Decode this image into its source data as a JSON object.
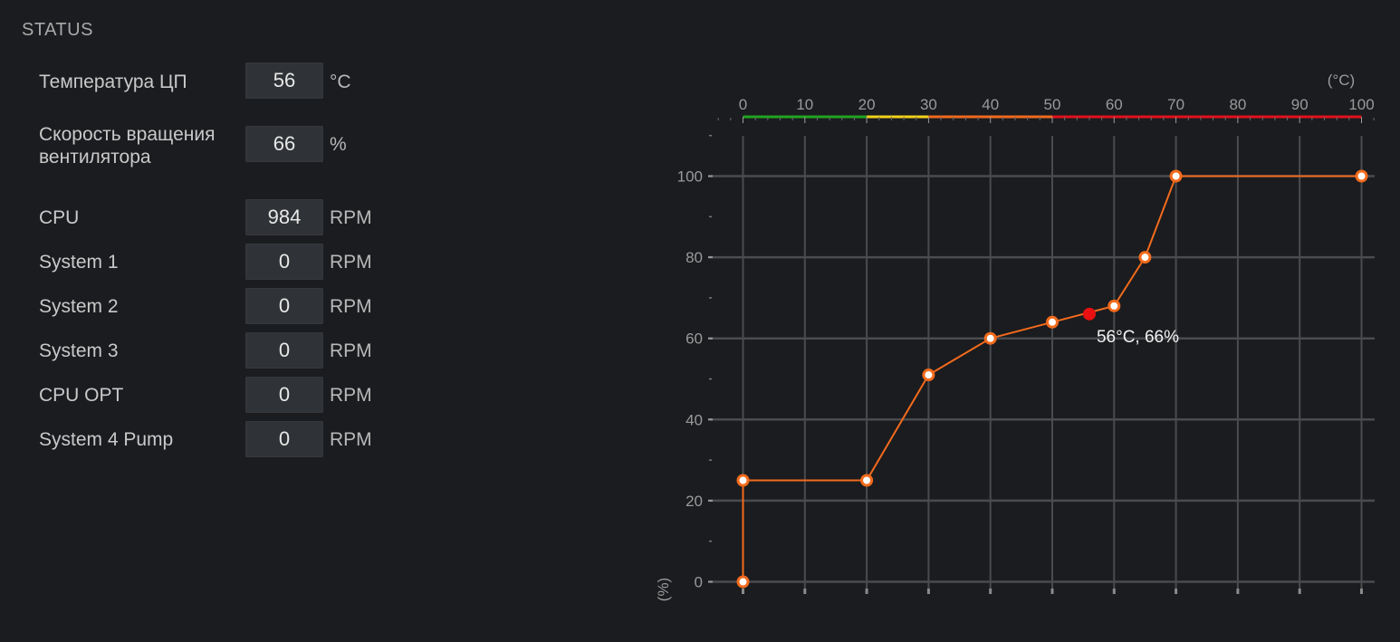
{
  "status": {
    "title": "STATUS",
    "cpu_temp": {
      "label": "Температура ЦП",
      "value": "56",
      "unit": "°C"
    },
    "fan_speed": {
      "label_line1": "Скорость вращения",
      "label_line2": "вентилятора",
      "value": "66",
      "unit": "%"
    },
    "fans": [
      {
        "label": "CPU",
        "value": "984",
        "unit": "RPM"
      },
      {
        "label": "System 1",
        "value": "0",
        "unit": "RPM"
      },
      {
        "label": "System 2",
        "value": "0",
        "unit": "RPM"
      },
      {
        "label": "System 3",
        "value": "0",
        "unit": "RPM"
      },
      {
        "label": "CPU OPT",
        "value": "0",
        "unit": "RPM"
      },
      {
        "label": "System 4 Pump",
        "value": "0",
        "unit": "RPM"
      }
    ]
  },
  "chart_data": {
    "type": "line",
    "x_unit_label": "(°C)",
    "y_unit_label": "(%)",
    "xlim": [
      0,
      100
    ],
    "ylim": [
      0,
      100
    ],
    "x_ticks": [
      0,
      10,
      20,
      30,
      40,
      50,
      60,
      70,
      80,
      90,
      100
    ],
    "y_ticks": [
      0,
      20,
      40,
      60,
      80,
      100
    ],
    "grid": true,
    "series": [
      {
        "color": "#f26b1d",
        "points": [
          [
            0,
            0
          ],
          [
            0,
            25
          ],
          [
            20,
            25
          ],
          [
            30,
            51
          ],
          [
            40,
            60
          ],
          [
            50,
            64
          ],
          [
            60,
            68
          ],
          [
            65,
            80
          ],
          [
            70,
            100
          ],
          [
            100,
            100
          ]
        ]
      }
    ],
    "current_point": {
      "x": 56,
      "y": 66,
      "label": "56°C, 66%",
      "color": "#e81010"
    },
    "temp_bands": [
      {
        "from": 0,
        "to": 20,
        "color": "#1fa61f"
      },
      {
        "from": 20,
        "to": 30,
        "color": "#f2d21a"
      },
      {
        "from": 30,
        "to": 50,
        "color": "#f26b1d"
      },
      {
        "from": 50,
        "to": 100,
        "color": "#e3101c"
      }
    ]
  }
}
